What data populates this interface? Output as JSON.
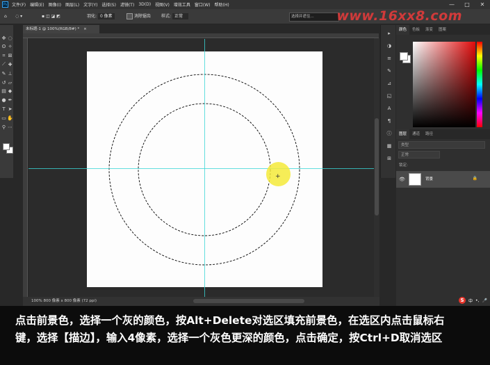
{
  "app": {
    "logo": "Ps"
  },
  "menubar": {
    "items": [
      "文件(F)",
      "编辑(E)",
      "图像(I)",
      "图层(L)",
      "文字(Y)",
      "选择(S)",
      "滤镜(T)",
      "3D(D)",
      "视图(V)",
      "增效工具",
      "窗口(W)",
      "帮助(H)"
    ],
    "window_controls": [
      "—",
      "□",
      "✕"
    ]
  },
  "options": {
    "feather_label": "羽化:",
    "feather_value": "0 像素",
    "antialias_label": "消除锯齿",
    "style_label": "样式:",
    "style_value": "正常",
    "select_mask_button": "选择并遮住..."
  },
  "watermark": "www.16xx8.com",
  "document": {
    "tab_title": "未标题-1 @ 100%(RGB/8#) *",
    "status": "100%    800 像素 x 800 像素 (72 ppi)"
  },
  "panels": {
    "color_tabs": [
      "颜色",
      "色板",
      "渐变",
      "图案"
    ],
    "layer_tabs": [
      "图层",
      "通道",
      "路径"
    ],
    "layer_search": "类型",
    "blend_mode": "正常",
    "lock_label": "锁定:",
    "layer_name": "背景"
  },
  "ime": {
    "symbol": "S",
    "label": "中"
  },
  "caption": {
    "line1": "点击前景色，选择一个灰的颜色，按Alt+Delete对选区填充前景色，在选区内点击鼠标右",
    "line2": "键，选择【描边】，输入4像素，选择一个灰色更深的颜色，点击确定，按Ctrl+D取消选区"
  },
  "colors": {
    "guide": "#3bd6d6",
    "highlight": "#f5ea3a",
    "picker_hue": "#e10b0b"
  }
}
